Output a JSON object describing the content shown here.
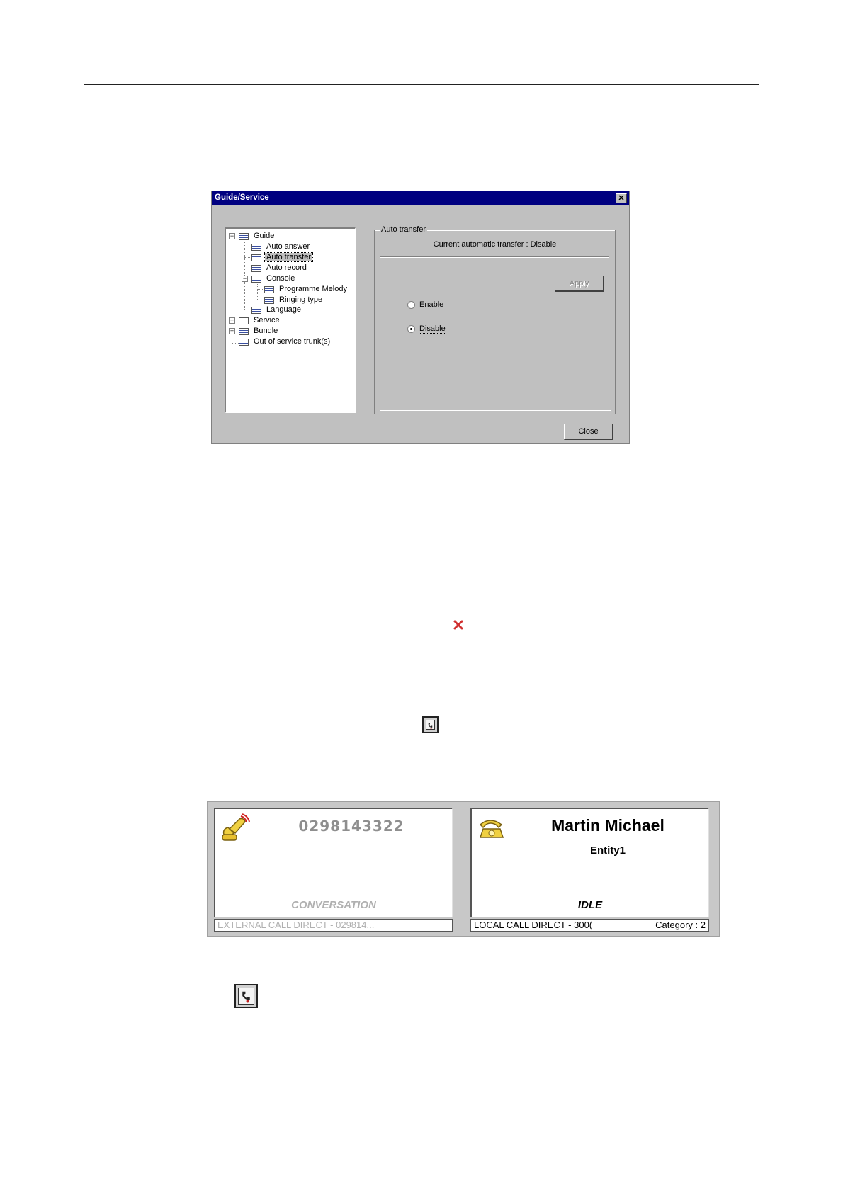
{
  "dialog": {
    "title": "Guide/Service",
    "close_glyph": "✕",
    "tree": [
      {
        "label": "Guide",
        "icon": "list-icon"
      },
      {
        "label": "Auto answer",
        "icon": "list-icon"
      },
      {
        "label": "Auto transfer",
        "icon": "list-icon",
        "selected": true
      },
      {
        "label": "Auto record",
        "icon": "list-icon"
      },
      {
        "label": "Console",
        "icon": "list-icon"
      },
      {
        "label": "Programme Melody",
        "icon": "list-icon"
      },
      {
        "label": "Ringing type",
        "icon": "list-icon"
      },
      {
        "label": "Language",
        "icon": "list-icon"
      },
      {
        "label": "Service",
        "icon": "list-icon"
      },
      {
        "label": "Bundle",
        "icon": "list-icon"
      },
      {
        "label": "Out of service trunk(s)",
        "icon": "list-icon"
      }
    ],
    "expanders": {
      "minus": "−",
      "plus": "+"
    },
    "group_title": "Auto transfer",
    "current_status": "Current automatic transfer : Disable",
    "apply_label": "Apply",
    "radios": [
      {
        "label": "Enable",
        "checked": false
      },
      {
        "label": "Disable",
        "checked": true
      }
    ],
    "close_label": "Close"
  },
  "icons": {
    "red_x": "close-red-icon",
    "small_box": "phone-box-icon",
    "large_box": "phone-box-icon"
  },
  "call_panel": {
    "left": {
      "number": "0298143322",
      "state": "CONVERSATION",
      "status": "EXTERNAL CALL DIRECT - 029814..."
    },
    "right": {
      "name": "Martin Michael",
      "entity": "Entity1",
      "state": "IDLE",
      "status": "LOCAL CALL DIRECT - 300(",
      "category": "Category : 2"
    }
  },
  "colors": {
    "titlebar": "#000080",
    "dialog_bg": "#c0c0c0",
    "red_x": "#d03030",
    "handset_yellow": "#f0d040"
  }
}
